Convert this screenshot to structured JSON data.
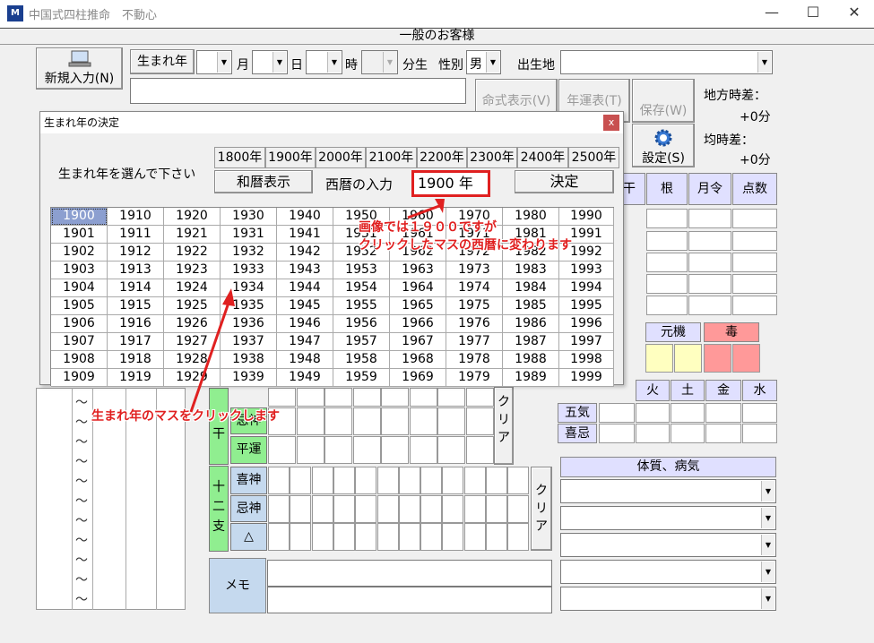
{
  "window": {
    "title": "中国式四柱推命　不動心",
    "icon_label": "M",
    "min": "—",
    "max": "☐",
    "close": "✕"
  },
  "banner": "一般のお客様",
  "toolbar": {
    "new_input": "新規入力(N)",
    "birth_year": "生まれ年",
    "month": "月",
    "day": "日",
    "hour": "時",
    "minute": "分生",
    "gender_label": "性別",
    "gender_value": "男",
    "birthplace": "出生地"
  },
  "buttons": {
    "display": "命式表示(V)",
    "fortune": "年運表(T)",
    "save": "保存(W)",
    "settings": "設定(S)"
  },
  "time_diff": {
    "local_label": "地方時差：",
    "local_value": "+0分",
    "mean_label": "均時差：",
    "mean_value": "+0分"
  },
  "right_table_headers": [
    "干",
    "根",
    "月令",
    "点数"
  ],
  "genki_headers": {
    "genki": "元機",
    "doku": "毒"
  },
  "elements": [
    "火",
    "土",
    "金",
    "水"
  ],
  "rows_labels": {
    "gogi": "五気",
    "kiki": "喜忌"
  },
  "taishitsu": "体質、病気",
  "left_panel": {
    "kan": "干",
    "kishin": "忌神",
    "heiun": "平運",
    "jyuni": "十二支",
    "kishin2": "喜神",
    "kishin3": "忌神",
    "triangle": "△",
    "clear1": "クリア",
    "clear2": "クリア",
    "memo": "メモ"
  },
  "tildes": [
    "～",
    "～",
    "～",
    "～",
    "～",
    "～",
    "～",
    "～",
    "～",
    "～",
    "～"
  ],
  "dialog": {
    "title": "生まれ年の決定",
    "close": "x",
    "prompt": "生まれ年を選んで下さい",
    "centuries": [
      "1800年",
      "1900年",
      "2000年",
      "2100年",
      "2200年",
      "2300年",
      "2400年",
      "2500年"
    ],
    "wareki_button": "和暦表示",
    "seireki_label": "西暦の入力",
    "seireki_value": "1900",
    "seireki_suffix": "年",
    "decide": "決定",
    "selected": "1900",
    "years": [
      [
        "1900",
        "1910",
        "1920",
        "1930",
        "1940",
        "1950",
        "1960",
        "1970",
        "1980",
        "1990"
      ],
      [
        "1901",
        "1911",
        "1921",
        "1931",
        "1941",
        "1951",
        "1961",
        "1971",
        "1981",
        "1991"
      ],
      [
        "1902",
        "1912",
        "1922",
        "1932",
        "1942",
        "1952",
        "1962",
        "1972",
        "1982",
        "1992"
      ],
      [
        "1903",
        "1913",
        "1923",
        "1933",
        "1943",
        "1953",
        "1963",
        "1973",
        "1983",
        "1993"
      ],
      [
        "1904",
        "1914",
        "1924",
        "1934",
        "1944",
        "1954",
        "1964",
        "1974",
        "1984",
        "1994"
      ],
      [
        "1905",
        "1915",
        "1925",
        "1935",
        "1945",
        "1955",
        "1965",
        "1975",
        "1985",
        "1995"
      ],
      [
        "1906",
        "1916",
        "1926",
        "1936",
        "1946",
        "1956",
        "1966",
        "1976",
        "1986",
        "1996"
      ],
      [
        "1907",
        "1917",
        "1927",
        "1937",
        "1947",
        "1957",
        "1967",
        "1977",
        "1987",
        "1997"
      ],
      [
        "1908",
        "1918",
        "1928",
        "1938",
        "1948",
        "1958",
        "1968",
        "1978",
        "1988",
        "1998"
      ],
      [
        "1909",
        "1919",
        "1929",
        "1939",
        "1949",
        "1959",
        "1969",
        "1979",
        "1989",
        "1999"
      ]
    ]
  },
  "annotations": {
    "a1": "画像では１９００ですが",
    "a2": "クリックしたマスの西暦に変わります",
    "a3": "生まれ年のマスをクリックします"
  },
  "colors": {
    "highlight": "#e02020",
    "selected_cell": "#8c9fd0",
    "header_bg": "#e0e0ff",
    "green": "#90ee90",
    "memo": "#c5d9ee",
    "yellow": "#ffffc0",
    "pink": "#ff9999"
  }
}
